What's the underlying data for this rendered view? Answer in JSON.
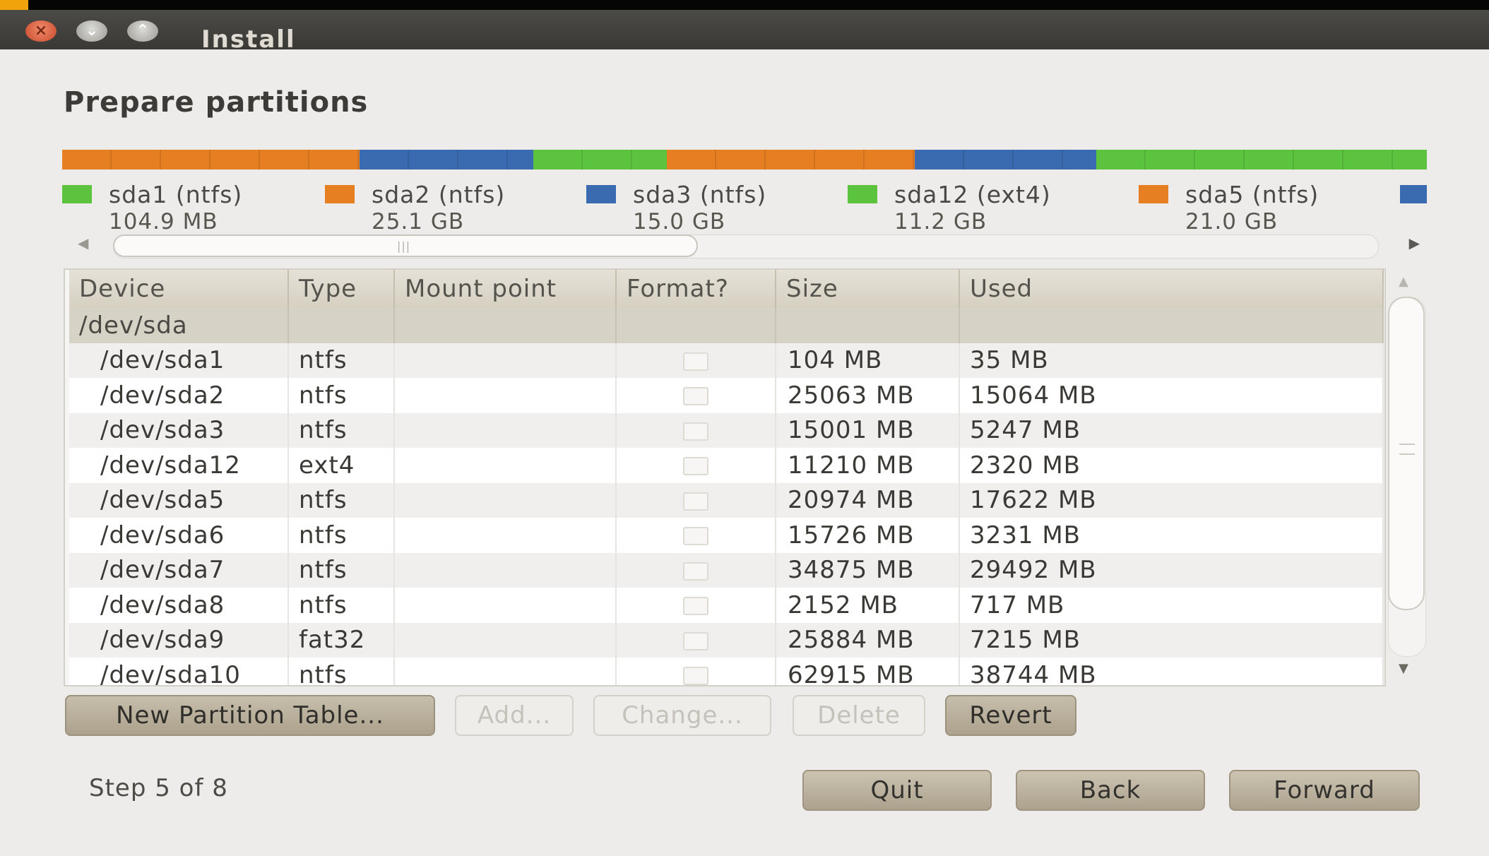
{
  "window": {
    "title": "Install"
  },
  "page": {
    "heading": "Prepare partitions"
  },
  "partition_bar": [
    {
      "name": "sda1 (ntfs)",
      "size": "104.9 MB",
      "color": "#e67e22",
      "share": 0.218
    },
    {
      "name": "sda2 (ntfs)",
      "size": "25.1 GB",
      "color": "#3a6bb0",
      "share": 0.127
    },
    {
      "name": "sda3 (ntfs)",
      "size": "15.0 GB",
      "color": "#5cc33e",
      "share": 0.098
    },
    {
      "name": "sda12 (ext4)",
      "size": "11.2 GB",
      "color": "#e67e22",
      "share": 0.182
    },
    {
      "name": "sda5 (ntfs)",
      "size": "21.0 GB",
      "color": "#3a6bb0",
      "share": 0.133
    },
    {
      "name": "",
      "size": "",
      "color": "#5cc33e",
      "share": 0.242
    }
  ],
  "legend": [
    {
      "name": "sda1 (ntfs)",
      "size": "104.9 MB",
      "color": "#5cc33e"
    },
    {
      "name": "sda2 (ntfs)",
      "size": "25.1 GB",
      "color": "#e67e22"
    },
    {
      "name": "sda3 (ntfs)",
      "size": "15.0 GB",
      "color": "#3a6bb0"
    },
    {
      "name": "sda12 (ext4)",
      "size": "11.2 GB",
      "color": "#5cc33e"
    },
    {
      "name": "sda5 (ntfs)",
      "size": "21.0 GB",
      "color": "#e67e22"
    },
    {
      "name": "",
      "size": "",
      "color": "#3a6bb0"
    }
  ],
  "table": {
    "columns": [
      "Device",
      "Type",
      "Mount point",
      "Format?",
      "Size",
      "Used"
    ],
    "group": "/dev/sda",
    "rows": [
      {
        "device": "/dev/sda1",
        "type": "ntfs",
        "mount": "",
        "size": "104 MB",
        "used": "35 MB"
      },
      {
        "device": "/dev/sda2",
        "type": "ntfs",
        "mount": "",
        "size": "25063 MB",
        "used": "15064 MB"
      },
      {
        "device": "/dev/sda3",
        "type": "ntfs",
        "mount": "",
        "size": "15001 MB",
        "used": "5247 MB"
      },
      {
        "device": "/dev/sda12",
        "type": "ext4",
        "mount": "",
        "size": "11210 MB",
        "used": "2320 MB"
      },
      {
        "device": "/dev/sda5",
        "type": "ntfs",
        "mount": "",
        "size": "20974 MB",
        "used": "17622 MB"
      },
      {
        "device": "/dev/sda6",
        "type": "ntfs",
        "mount": "",
        "size": "15726 MB",
        "used": "3231 MB"
      },
      {
        "device": "/dev/sda7",
        "type": "ntfs",
        "mount": "",
        "size": "34875 MB",
        "used": "29492 MB"
      },
      {
        "device": "/dev/sda8",
        "type": "ntfs",
        "mount": "",
        "size": "2152 MB",
        "used": "717 MB"
      },
      {
        "device": "/dev/sda9",
        "type": "fat32",
        "mount": "",
        "size": "25884 MB",
        "used": "7215 MB"
      },
      {
        "device": "/dev/sda10",
        "type": "ntfs",
        "mount": "",
        "size": "62915 MB",
        "used": "38744 MB"
      }
    ]
  },
  "actions": {
    "new_table": "New Partition Table...",
    "add": "Add...",
    "change": "Change...",
    "delete": "Delete",
    "revert": "Revert"
  },
  "footer": {
    "step": "Step 5 of 8",
    "quit": "Quit",
    "back": "Back",
    "forward": "Forward"
  },
  "icons": {
    "close": "close-icon",
    "minimize": "minimize-icon",
    "maximize": "maximize-icon",
    "scroll_left": "arrow-left-icon",
    "scroll_right": "arrow-right-icon",
    "scroll_up": "arrow-up-icon",
    "scroll_down": "arrow-down-icon"
  }
}
